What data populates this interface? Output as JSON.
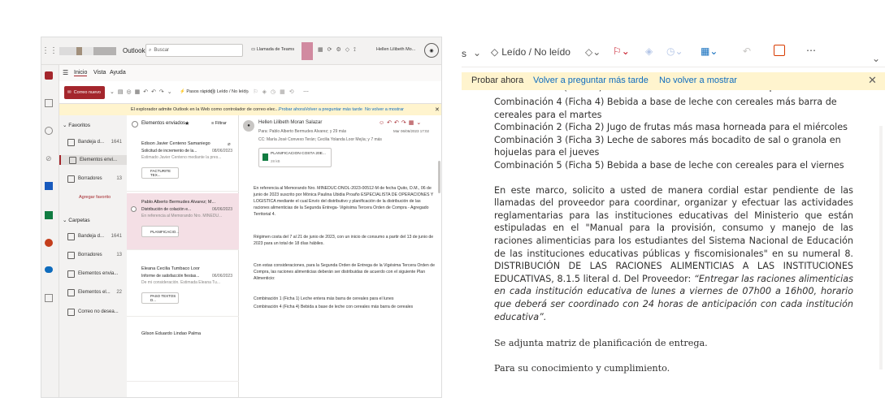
{
  "left": {
    "app_name": "Outlook",
    "search_placeholder": "Buscar",
    "teams_call": "Llamada de Teams",
    "user_name": "Hellen Lilibeth Mo...",
    "tabs": [
      "Inicio",
      "Vista",
      "Ayuda"
    ],
    "new_mail": "Correo nuevo",
    "quick_steps": "Pasos rápidos",
    "read_unread": "Leído / No leído",
    "notice": "El explorador admite Outlook en la Web como controlador de correo elec...",
    "notice_try": "Probar ahora",
    "notice_ask": "Volver a preguntar más tarde",
    "notice_never": "No volver a mostrar",
    "folders": {
      "favorites_header": "Favoritos",
      "fav_items": [
        {
          "label": "Bandeja d...",
          "count": "1641"
        },
        {
          "label": "Elementos envi...",
          "count": ""
        },
        {
          "label": "Borradores",
          "count": "13"
        }
      ],
      "add_favorite": "Agregar favorito",
      "folders_header": "Carpetas",
      "folder_items": [
        {
          "label": "Bandeja d...",
          "count": "1641"
        },
        {
          "label": "Borradores",
          "count": "13"
        },
        {
          "label": "Elementos envia...",
          "count": ""
        },
        {
          "label": "Elementos el...",
          "count": "22"
        },
        {
          "label": "Correo no desea...",
          "count": ""
        }
      ]
    },
    "list": {
      "header": "Elementos enviados",
      "filter": "Filtrar",
      "items": [
        {
          "from": "Edison Javier Centeno Samaniego",
          "subject": "Solicitud de incremento de la...",
          "date": "08/06/2023",
          "preview": "Estimado Javier Centeno mediante la pres...",
          "attachment": "FACTURITE TEX..."
        },
        {
          "from": "Pablo Alberto Bermudes Alvarez; M...",
          "subject": "Distribución de colación e...",
          "date": "06/06/2023",
          "preview": "En referencia al Memorando Nro. MINEDU...",
          "attachment": "PLANIFICACIO..."
        },
        {
          "from": "Eleana Cecilia Tumbaco Loor",
          "subject": "Informe de satisfacción fiestas...",
          "date": "06/06/2023",
          "preview": "De mi consideración. Estimada Eleana Tu...",
          "attachment": "PASO TEXTOS D..."
        },
        {
          "from": "Gilson Eduardo Lindao Palma",
          "subject": "",
          "date": "",
          "preview": "",
          "attachment": ""
        }
      ]
    },
    "reading": {
      "sender": "Hellen Lilibeth Moran Salazar",
      "to": "Para: Pablo Alberto Bermudes Alvarez; y 29 más",
      "cc": "CC: María José Convexo Terán; Cecilia Yolanda Loor Mejía; y 7 más",
      "date": "Mar 06/06/2023 17:02",
      "attachment": "PLANIFICACION COSTA 20E...",
      "attachment_size": "28 kB",
      "paragraphs": [
        "En referencia al Memorando Nro. MINEDUC-DNOL-2023-00512-M de fecha Quito, D.M., 06 de junio de 2023 suscrito por Mónica Paulina Ubidia Proaño ESPECIALISTA DE OPERACIONES Y LOGISTICA mediante el cual Envío del distributivo y planificación de la distribución de las raciones alimenticias de la Segunda Entrega- Vigésima Tercera Orden de Compra - Agregado Territorial 4.",
        "Régimen costa del 7 al 21 de junio de 2023, con un inicio de consumo a partir del 13 de junio de 2023 para un total de 18 días hábiles.",
        "Con estas consideraciones, para la Segunda Orden de Entrega de la Vigésima Tercera Orden de Compra, las raciones alimenticias deberán ser distribuidas de acuerdo con el siguiente Plan Alimenticio:",
        "Combinación 1 (Ficha 1) Leche entera más barra de cereales para el lunes",
        "Combinación 4 (Ficha 4) Bebida a base de leche con cereales más barra de cereales"
      ]
    }
  },
  "right": {
    "toolbar_prefix": "s",
    "read_unread": "Leído / No leído",
    "notice_try": "Probar ahora",
    "notice_ask": "Volver a preguntar más tarde",
    "notice_never": "No volver a mostrar",
    "hidden_line": "Combinación 1 (Ficha 1) Leche entera más barra de cereales para el lunes",
    "combo_lines": [
      "Combinación 4 (Ficha 4) Bebida a base de leche con cereales más barra de cereales para el martes",
      "Combinación 2 (Ficha 2) Jugo de frutas más masa horneada para el miércoles",
      "Combinación 3 (Ficha 3) Leche de sabores más bocadito de sal o granola en hojuelas para el jueves",
      "Combinación 5 (Ficha 5) Bebida a base de leche con cereales para el viernes"
    ],
    "main_paragraph": "En este marco, solicito a usted de manera cordial estar pendiente de las llamadas del proveedor para coordinar, organizar y efectuar las actividades reglamentarias para las instituciones educativas del Ministerio que están estipuladas en el \"Manual para la provisión, consumo y manejo de las raciones alimenticias para los estudiantes del Sistema Nacional de Educación de las instituciones educativas públicas y fiscomisionales\" en su numeral 8. DISTRIBUCIÓN DE LAS RACIONES ALIMENTICIAS A LAS INSTITUCIONES EDUCATIVAS, 8.1.5 literal d. Del Proveedor:",
    "quote": "“Entregar las raciones alimenticias en cada institución educativa de lunes a viernes de 07h00 a 16h00, horario que deberá ser coordinado con 24 horas de anticipación con cada institución educativa”.",
    "attach_line": "Se adjunta matriz de planificación de entrega.",
    "closing": "Para su conocimiento y cumplimiento."
  },
  "colors": {
    "accent": "#a4262c",
    "notice_bg": "#fff4ce",
    "selected": "#f4dfe5"
  }
}
